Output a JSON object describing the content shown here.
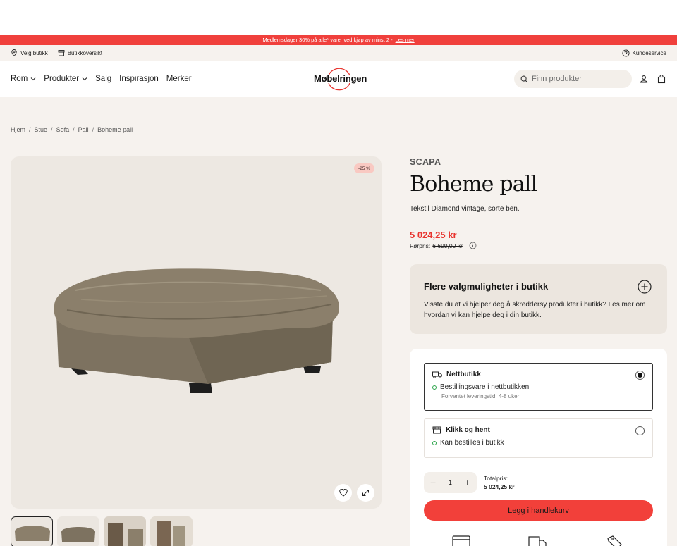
{
  "promo": {
    "text": "Medlemsdager  30% på alle* varer ved kjøp av minst 2 - ",
    "link": "Les mer"
  },
  "utility": {
    "store": "Velg butikk",
    "overview": "Butikkoversikt",
    "service": "Kundeservice"
  },
  "header": {
    "nav": [
      "Rom",
      "Produkter",
      "Salg",
      "Inspirasjon",
      "Merker"
    ],
    "logo": "Møbelringen",
    "search_placeholder": "Finn produkter",
    "icons": [
      "user-icon",
      "bag-icon"
    ]
  },
  "breadcrumb": [
    "Hjem",
    "Stue",
    "Sofa",
    "Pall",
    "Boheme pall"
  ],
  "gallery": {
    "badge": "-25 %",
    "thumbnail_count": 4
  },
  "product": {
    "brand": "SCAPA",
    "title": "Boheme pall",
    "description": "Tekstil Diamond vintage, sorte ben.",
    "price": "5 024,25 kr",
    "previous_price_label": "Førpris:",
    "previous_price": "6 699,00 kr"
  },
  "info_box": {
    "title": "Flere valgmuligheter i butikk",
    "text": "Visste du at vi hjelper deg å skreddersy produkter i butikk? Les mer om hvordan vi kan hjelpe deg i din butikk."
  },
  "delivery": {
    "options": [
      {
        "title": "Nettbutikk",
        "status": "Bestillingsvare i nettbutikken",
        "note": "Forventet leveringstid: 4-8 uker",
        "selected": true
      },
      {
        "title": "Klikk og hent",
        "status": "Kan bestilles i butikk",
        "note": "",
        "selected": false
      }
    ]
  },
  "cart": {
    "quantity": "1",
    "minus": "−",
    "plus": "+",
    "total_label": "Totalpris:",
    "total_value": "5 024,25 kr",
    "button": "Legg i handlekurv"
  },
  "colors": {
    "accent": "#f2403a",
    "promo_bg": "#f0403c",
    "price": "#e8342e",
    "stock_dot": "#2ba34a",
    "page_bg": "#f6f2ee"
  }
}
